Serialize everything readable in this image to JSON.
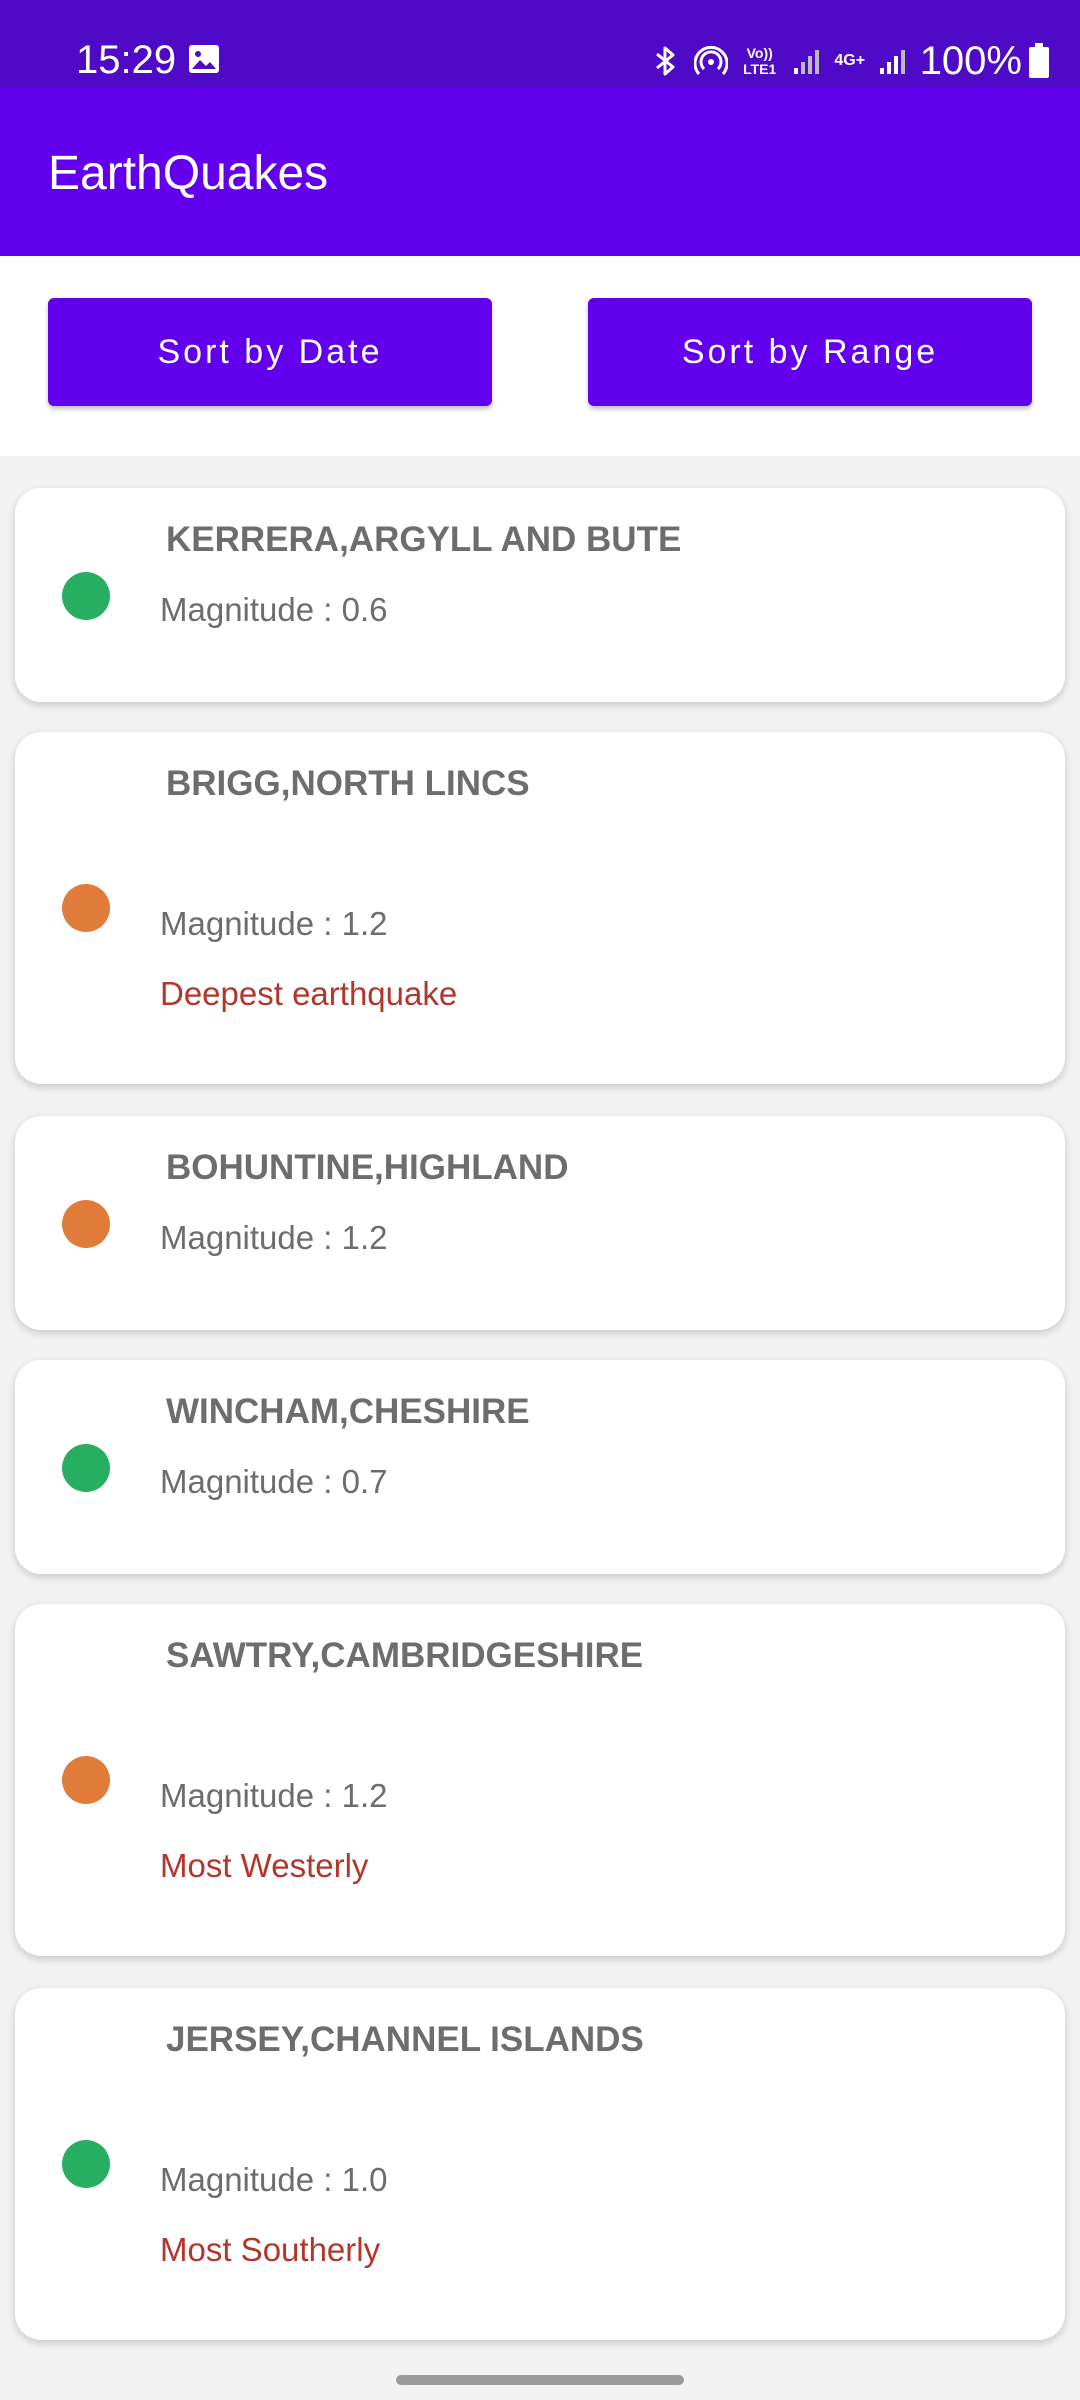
{
  "status_bar": {
    "time": "15:29",
    "volte_line1": "Vo))",
    "volte_line2": "LTE1",
    "network": "4G+",
    "battery": "100%",
    "icons": [
      "gallery-icon",
      "bluetooth-icon",
      "hotspot-icon",
      "signal-icon",
      "battery-icon"
    ]
  },
  "app_bar": {
    "title": "EarthQuakes"
  },
  "sort_buttons": {
    "date_label": "Sort by Date",
    "range_label": "Sort by Range"
  },
  "colors": {
    "primary": "#6200ee",
    "status_bar": "#4e0ac7",
    "low_magnitude": "#27ae60",
    "high_magnitude": "#e07b39",
    "note_text": "#b3362c",
    "body_text": "#6d6d6d"
  },
  "earthquakes": [
    {
      "place": "KERRERA,ARGYLL AND BUTE",
      "magnitude": "Magnitude : 0.6",
      "note": "",
      "dot": "green"
    },
    {
      "place": "BRIGG,NORTH LINCS",
      "magnitude": "Magnitude : 1.2",
      "note": "Deepest earthquake",
      "dot": "orange"
    },
    {
      "place": "BOHUNTINE,HIGHLAND",
      "magnitude": "Magnitude : 1.2",
      "note": "",
      "dot": "orange"
    },
    {
      "place": "WINCHAM,CHESHIRE",
      "magnitude": "Magnitude : 0.7",
      "note": "",
      "dot": "green"
    },
    {
      "place": "SAWTRY,CAMBRIDGESHIRE",
      "magnitude": "Magnitude : 1.2",
      "note": "Most Westerly",
      "dot": "orange"
    },
    {
      "place": "JERSEY,CHANNEL ISLANDS",
      "magnitude": "Magnitude : 1.0",
      "note": "Most Southerly",
      "dot": "green"
    }
  ]
}
